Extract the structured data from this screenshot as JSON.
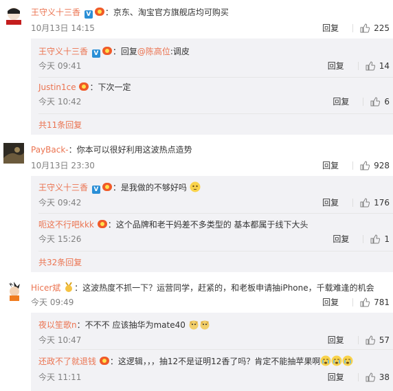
{
  "comments": [
    {
      "author": "王守义十三香",
      "text": "京东、淘宝官方旗舰店均可购买",
      "time": "10月13日 14:15",
      "reply_label": "回复",
      "likes": "225",
      "replies": [
        {
          "author": "王守义十三香",
          "text_prefix": "回复",
          "mention": "@陈高位",
          "text": ":调皮",
          "time": "今天 09:41",
          "reply_label": "回复",
          "likes": "14"
        },
        {
          "author": "Justin1ce",
          "text": "下次一定",
          "time": "今天 10:42",
          "reply_label": "回复",
          "likes": "6"
        }
      ],
      "more": "共11条回复"
    },
    {
      "author": "PayBack-",
      "text": "你本可以很好利用这波热点造势",
      "time": "10月13日 23:30",
      "reply_label": "回复",
      "likes": "928",
      "replies": [
        {
          "author": "王守义十三香",
          "text": "是我做的不够好吗",
          "time": "今天 09:42",
          "reply_label": "回复",
          "likes": "176"
        },
        {
          "author": "呃这不行吧kkk",
          "text": "这个品牌和老干妈差不多类型的 基本都属于线下大头",
          "time": "今天 15:26",
          "reply_label": "回复",
          "likes": "1"
        }
      ],
      "more": "共32条回复"
    },
    {
      "author": "Hicer斌",
      "text": "这波热度不抓一下？运营同学，赶紧的，和老板申请抽iPhone，千载难逢的机会",
      "time": "今天 09:49",
      "reply_label": "回复",
      "likes": "781",
      "replies": [
        {
          "author": "夜以笙歌n",
          "text": "不不不 应该抽华为mate40",
          "time": "今天 10:47",
          "reply_label": "回复",
          "likes": "57"
        },
        {
          "author": "还政不了就退钱",
          "text": "这逻辑，，，抽12不是证明12香了吗？肯定不能抽苹果啊",
          "time": "今天 11:11",
          "reply_label": "回复",
          "likes": "38"
        }
      ]
    }
  ],
  "colors": {
    "name": "#eb7350",
    "muted": "#808080",
    "reply_bg": "#f2f2f5"
  }
}
